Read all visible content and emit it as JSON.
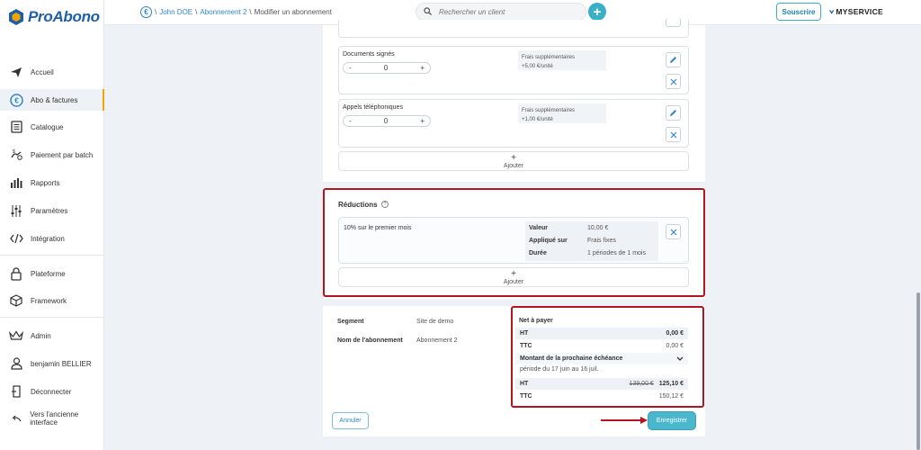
{
  "brand": {
    "name": "ProAbono"
  },
  "sidebar": {
    "items": [
      {
        "label": "Accueil",
        "icon": "plane-icon"
      },
      {
        "label": "Abo & factures",
        "icon": "euro-icon",
        "active": true
      },
      {
        "label": "Catalogue",
        "icon": "catalog-icon"
      },
      {
        "label": "Paiement par batch",
        "icon": "batch-payment-icon"
      },
      {
        "label": "Rapports",
        "icon": "bar-chart-icon"
      },
      {
        "label": "Paramètres",
        "icon": "sliders-icon"
      },
      {
        "label": "Intégration",
        "icon": "code-icon"
      },
      {
        "label": "Plateforme",
        "icon": "lock-icon"
      },
      {
        "label": "Framework",
        "icon": "cube-icon"
      },
      {
        "label": "Admin",
        "icon": "crown-icon"
      },
      {
        "label": "benjamin BELLIER",
        "icon": "user-icon"
      },
      {
        "label": "Déconnecter",
        "icon": "logout-icon"
      },
      {
        "label": "Vers l'ancienne interface",
        "icon": "back-arrow-icon"
      }
    ]
  },
  "breadcrumb": {
    "customer": "John DOE",
    "subscription": "Abonnement 2",
    "current": "Modifier un abonnement",
    "separator": "\\"
  },
  "search": {
    "placeholder": "Rechercher un client"
  },
  "header": {
    "subscribe_label": "Souscrire",
    "partner_logo": "MYSERVICE"
  },
  "options": [
    {
      "name": "Documents signés",
      "value": "0",
      "minus": "-",
      "plus": "+",
      "frais_title": "Frais supplémentaires",
      "frais_value": "+5,00 €/unité"
    },
    {
      "name": "Appels téléphoniques",
      "value": "0",
      "minus": "-",
      "plus": "+",
      "frais_title": "Frais supplémentaires",
      "frais_value": "+1,00 €/unité"
    }
  ],
  "add_label": "Ajouter",
  "add_symbol": "+",
  "reductions": {
    "title": "Réductions",
    "item": {
      "label": "10% sur le premier mois",
      "rows": [
        {
          "key": "Valeur",
          "value": "10,00 €"
        },
        {
          "key": "Appliqué sur",
          "value": "Frais fixes"
        },
        {
          "key": "Durée",
          "value": "1 périodes de 1 mois"
        }
      ]
    }
  },
  "summary": {
    "segment_label": "Segment",
    "segment_value": "Site de demo",
    "name_label": "Nom de l'abonnement",
    "name_value": "Abonnement 2"
  },
  "net": {
    "title": "Net à payer",
    "ht_label": "HT",
    "ht_value": "0,00 €",
    "ttc_label": "TTC",
    "ttc_value": "0,00 €",
    "next_title": "Montant de la prochaine échéance",
    "period": "période du 17 juin au 16 juil.",
    "next_ht_label": "HT",
    "next_ht_old": "139,00 €",
    "next_ht_value": "125,10 €",
    "next_ttc_label": "TTC",
    "next_ttc_value": "150,12 €"
  },
  "actions": {
    "cancel_label": "Annuler",
    "save_label": "Enregistrer"
  },
  "colors": {
    "brand": "#1f5fa8",
    "accent": "#4bb7cd",
    "highlight": "#b3141d"
  }
}
